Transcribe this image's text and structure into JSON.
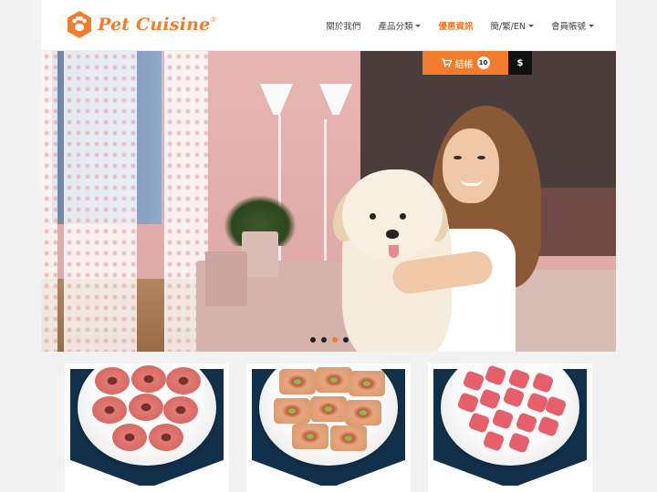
{
  "brand": {
    "name": "Pet Cuisine",
    "registered": "®",
    "accent": "#f07c2c"
  },
  "nav": {
    "items": [
      {
        "label": "關於我們",
        "dropdown": false,
        "active": false
      },
      {
        "label": "產品分類",
        "dropdown": true,
        "active": false
      },
      {
        "label": "優惠資訊",
        "dropdown": false,
        "active": true
      },
      {
        "label": "簡/繁/EN",
        "dropdown": true,
        "active": false
      },
      {
        "label": "會員帳號",
        "dropdown": true,
        "active": false
      }
    ]
  },
  "cart": {
    "label": "結帳",
    "count": "10",
    "icon": "cart-icon",
    "currency_label": "$"
  },
  "hero": {
    "slides": 4,
    "active_slide": 3
  },
  "products": [
    {
      "name": "donut-treats"
    },
    {
      "name": "rolled-treats"
    },
    {
      "name": "heart-treats"
    }
  ],
  "colors": {
    "accent": "#f07c2c",
    "navy": "#11304a",
    "dark": "#111111"
  }
}
